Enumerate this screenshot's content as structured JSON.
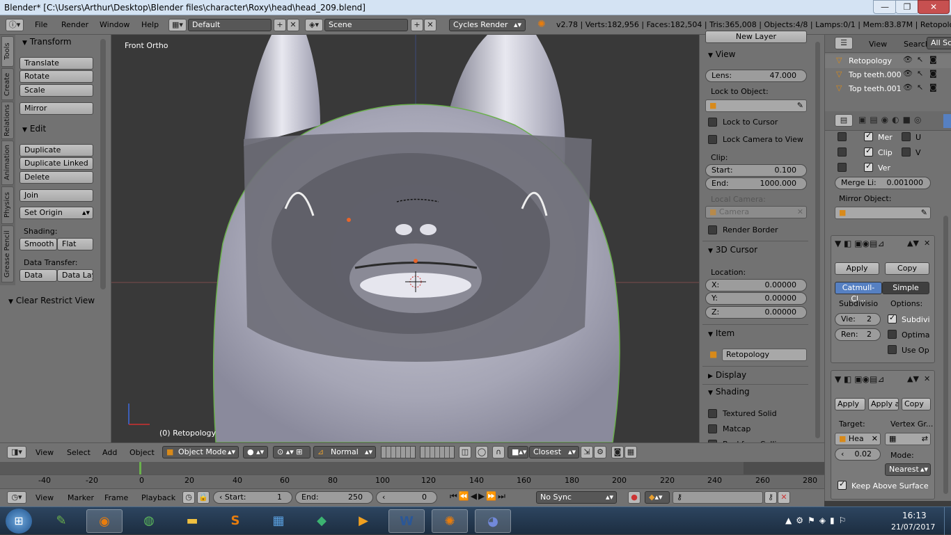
{
  "window": {
    "title": "Blender* [C:\\Users\\Arthur\\Desktop\\Blender files\\character\\Roxy\\head\\head_209.blend]",
    "min": "—",
    "max": "❐",
    "close": "✕"
  },
  "infobar": {
    "menus": [
      "File",
      "Render",
      "Window",
      "Help"
    ],
    "layout": "Default",
    "scene": "Scene",
    "engine": "Cycles Render",
    "stats": "v2.78 | Verts:182,956 | Faces:182,504 | Tris:365,008 | Objects:4/8 | Lamps:0/1 | Mem:83.87M | Retopology"
  },
  "tabs": [
    "Tools",
    "Create",
    "Relations",
    "Animation",
    "Physics",
    "Grease Pencil"
  ],
  "tools": {
    "transform_header": "Transform",
    "translate": "Translate",
    "rotate": "Rotate",
    "scale": "Scale",
    "mirror": "Mirror",
    "edit_header": "Edit",
    "duplicate": "Duplicate",
    "duplicate_linked": "Duplicate Linked",
    "delete": "Delete",
    "join": "Join",
    "set_origin": "Set Origin",
    "shading_label": "Shading:",
    "smooth": "Smooth",
    "flat": "Flat",
    "data_transfer_label": "Data Transfer:",
    "data": "Data",
    "data_lay": "Data Lay",
    "clear_restrict": "Clear Restrict View"
  },
  "viewport": {
    "view_name": "Front Ortho",
    "object_label": "(0) Retopology"
  },
  "npanel": {
    "new_layer": "New Layer",
    "view_header": "View",
    "lens_label": "Lens:",
    "lens_value": "47.000",
    "lock_to_object": "Lock to Object:",
    "lock_to_cursor": "Lock to Cursor",
    "lock_camera": "Lock Camera to View",
    "clip_label": "Clip:",
    "start_label": "Start:",
    "start_value": "0.100",
    "end_label": "End:",
    "end_value": "1000.000",
    "local_camera": "Local Camera:",
    "camera": "Camera",
    "render_border": "Render Border",
    "cursor_header": "3D Cursor",
    "location": "Location:",
    "x_label": "X:",
    "x": "0.00000",
    "y_label": "Y:",
    "y": "0.00000",
    "z_label": "Z:",
    "z": "0.00000",
    "item_header": "Item",
    "item_name": "Retopology",
    "display_header": "Display",
    "shading_header": "Shading",
    "textured_solid": "Textured Solid",
    "matcap": "Matcap",
    "backface": "Backface Culling"
  },
  "outliner": {
    "view": "View",
    "search": "Search",
    "all_scenes": "All Sc",
    "items": [
      "Retopology",
      "Top teeth.000",
      "Top teeth.001"
    ]
  },
  "props": {
    "mer": "Mer",
    "u": "U",
    "clip": "Clip",
    "v": "V",
    "ver": "Ver",
    "merge_label": "Merge Li:",
    "merge_value": "0.001000",
    "mirror_object": "Mirror Object:",
    "apply": "Apply",
    "copy": "Copy",
    "catmull": "Catmull-Cl...",
    "simple": "Simple",
    "subdiv_label": "Subdivisio",
    "options_label": "Options:",
    "view_label": "Vie:",
    "view_value": "2",
    "render_label": "Ren:",
    "render_value": "2",
    "subdivi": "Subdivi",
    "optima": "Optima",
    "useop": "Use Op",
    "apply2": "Apply",
    "apply_a": "Apply a",
    "copy2": "Copy",
    "target": "Target:",
    "vertex_gr": "Vertex Gr...",
    "target_value": "Hea",
    "offset_value": "0.02",
    "mode_label": "Mode:",
    "mode_value": "Nearest",
    "keep_above": "Keep Above Surface"
  },
  "vpheader": {
    "view": "View",
    "select": "Select",
    "add": "Add",
    "object": "Object",
    "mode": "Object Mode",
    "orientation": "Normal",
    "snap": "Closest"
  },
  "timeline": {
    "ticks": [
      "-40",
      "-20",
      "0",
      "20",
      "40",
      "60",
      "80",
      "100",
      "120",
      "140",
      "160",
      "180",
      "200",
      "220",
      "240",
      "260",
      "280"
    ]
  },
  "tlheader": {
    "view": "View",
    "marker": "Marker",
    "frame": "Frame",
    "playback": "Playback",
    "start_label": "Start:",
    "start": "1",
    "end_label": "End:",
    "end": "250",
    "current": "0",
    "sync": "No Sync"
  },
  "taskbar": {
    "time": "16:13",
    "date": "21/07/2017"
  }
}
